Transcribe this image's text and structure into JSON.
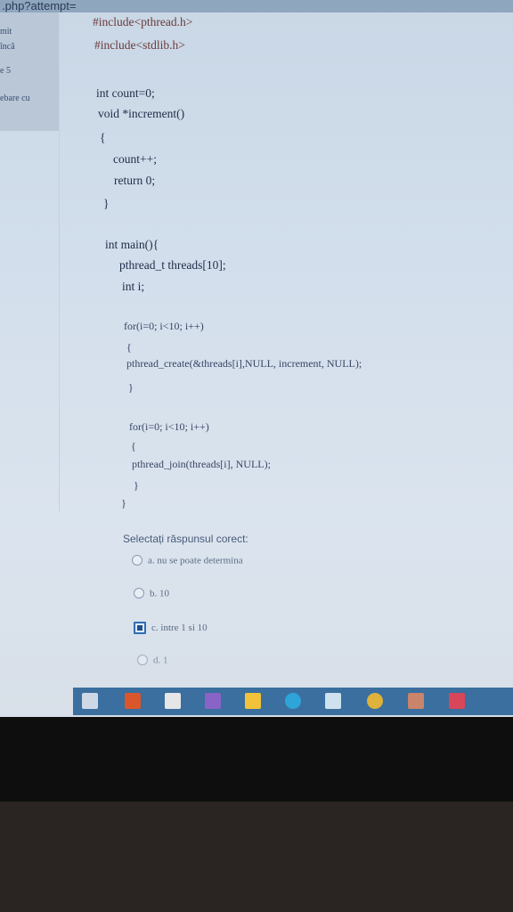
{
  "browser": {
    "url_fragment": ".php?attempt="
  },
  "sidebar": {
    "items": [
      {
        "label": "mit"
      },
      {
        "label": "încă"
      },
      {
        "label": "e 5"
      },
      {
        "label": "ebare cu"
      }
    ]
  },
  "code": {
    "lines": [
      "#include<pthread.h>",
      "#include<stdlib.h>",
      "int count=0;",
      "void *increment()",
      "{",
      "count++;",
      "return 0;",
      "}",
      "int main(){",
      "pthread_t threads[10];",
      "int i;",
      "for(i=0; i<10; i++)",
      "{",
      "pthread_create(&threads[i],NULL, increment, NULL);",
      "}",
      "for(i=0; i<10; i++)",
      "{",
      "pthread_join(threads[i], NULL);",
      "}",
      "}"
    ]
  },
  "quiz": {
    "prompt": "Selectați răspunsul corect:",
    "options": [
      {
        "label": "a.  nu se poate determina",
        "selected": false
      },
      {
        "label": "b. 10",
        "selected": false
      },
      {
        "label": "c. intre 1 si 10",
        "selected": true
      },
      {
        "label": "d. 1",
        "selected": false
      }
    ]
  },
  "taskbar": {
    "icons": [
      {
        "name": "task-view-icon",
        "color": "#cfd9e6"
      },
      {
        "name": "office-icon",
        "color": "#d9572b"
      },
      {
        "name": "store-icon",
        "color": "#e6e6e6"
      },
      {
        "name": "visual-studio-icon",
        "color": "#8a63c7"
      },
      {
        "name": "file-explorer-icon",
        "color": "#f2c33a"
      },
      {
        "name": "edge-icon",
        "color": "#2fa4d9"
      },
      {
        "name": "app-icon",
        "color": "#cfe0ef"
      },
      {
        "name": "chrome-icon",
        "color": "#e0b23a"
      },
      {
        "name": "paint-icon",
        "color": "#c9846a"
      },
      {
        "name": "calendar-icon",
        "color": "#d8465a"
      }
    ]
  }
}
